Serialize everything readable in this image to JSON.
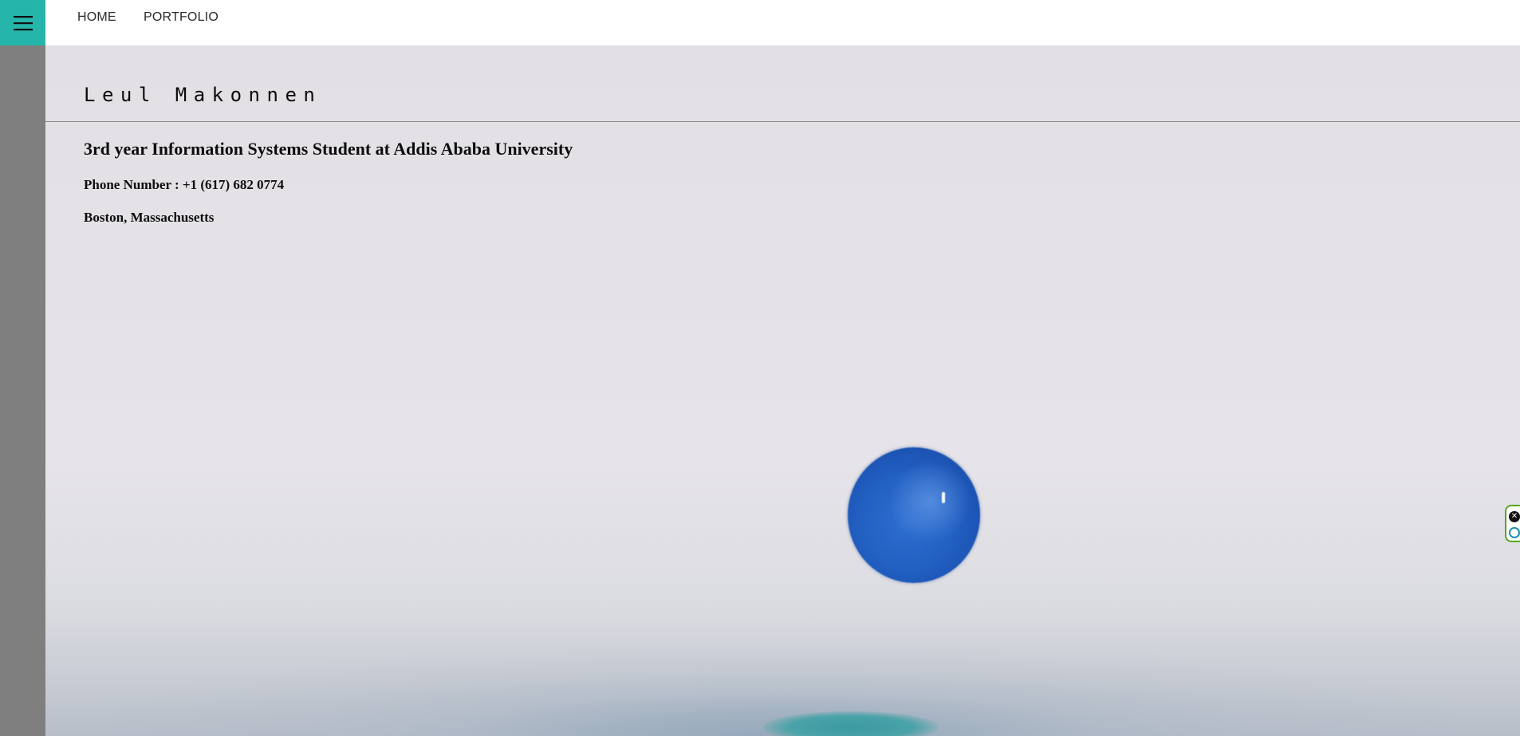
{
  "nav": {
    "menu_icon": "hamburger-menu-icon",
    "items": [
      {
        "label": "HOME"
      },
      {
        "label": "PORTFOLIO"
      }
    ]
  },
  "hero": {
    "name": "Leul Makonnen",
    "subtitle": "3rd year Information Systems Student at Addis Ababa University",
    "phone": "Phone Number : +1 (617) 682 0774",
    "location": "Boston, Massachusetts",
    "background_image": "blue-water-droplet"
  },
  "extension_widget": {
    "close_icon": "close-icon",
    "logo_icon": "extension-logo-icon"
  },
  "colors": {
    "accent": "#26b5aa",
    "sidebar": "#7f7f7f",
    "topbar": "#ffffff",
    "text": "#0d0d0d",
    "drop": "#2260c2"
  }
}
